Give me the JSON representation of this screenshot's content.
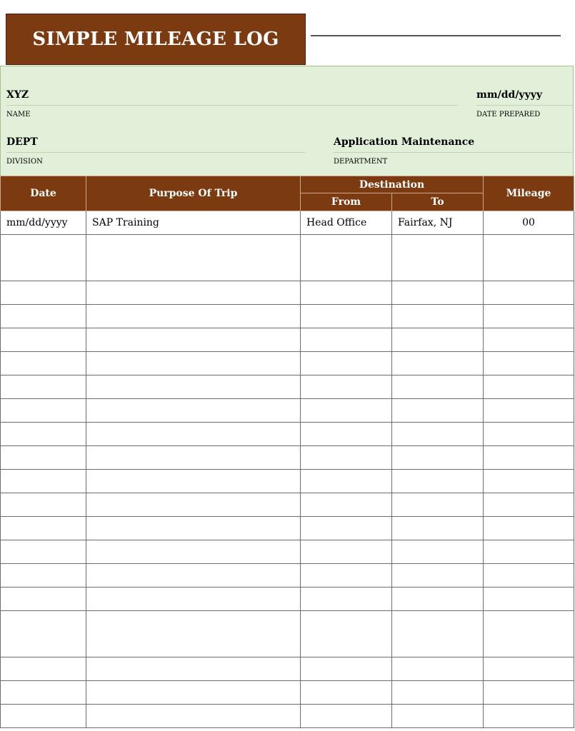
{
  "header": {
    "title": "SIMPLE MILEAGE LOG"
  },
  "info": {
    "name_value": "XYZ",
    "name_label": "NAME",
    "date_value": "mm/dd/yyyy",
    "date_label": "DATE PREPARED",
    "division_value": "DEPT",
    "division_label": "DIVISION",
    "department_value": "Application Maintenance",
    "department_label": "DEPARTMENT"
  },
  "table": {
    "columns": {
      "date": "Date",
      "purpose": "Purpose Of Trip",
      "destination": "Destination",
      "from": "From",
      "to": "To",
      "mileage": "Mileage"
    },
    "rows": [
      {
        "date": "mm/dd/yyyy",
        "purpose": "SAP Training",
        "from": "Head Office",
        "to": "Fairfax, NJ",
        "mileage": "00",
        "tall": false
      },
      {
        "date": "",
        "purpose": "",
        "from": "",
        "to": "",
        "mileage": "",
        "tall": true
      },
      {
        "date": "",
        "purpose": "",
        "from": "",
        "to": "",
        "mileage": "",
        "tall": false
      },
      {
        "date": "",
        "purpose": "",
        "from": "",
        "to": "",
        "mileage": "",
        "tall": false
      },
      {
        "date": "",
        "purpose": "",
        "from": "",
        "to": "",
        "mileage": "",
        "tall": false
      },
      {
        "date": "",
        "purpose": "",
        "from": "",
        "to": "",
        "mileage": "",
        "tall": false
      },
      {
        "date": "",
        "purpose": "",
        "from": "",
        "to": "",
        "mileage": "",
        "tall": false
      },
      {
        "date": "",
        "purpose": "",
        "from": "",
        "to": "",
        "mileage": "",
        "tall": false
      },
      {
        "date": "",
        "purpose": "",
        "from": "",
        "to": "",
        "mileage": "",
        "tall": false
      },
      {
        "date": "",
        "purpose": "",
        "from": "",
        "to": "",
        "mileage": "",
        "tall": false
      },
      {
        "date": "",
        "purpose": "",
        "from": "",
        "to": "",
        "mileage": "",
        "tall": false
      },
      {
        "date": "",
        "purpose": "",
        "from": "",
        "to": "",
        "mileage": "",
        "tall": false
      },
      {
        "date": "",
        "purpose": "",
        "from": "",
        "to": "",
        "mileage": "",
        "tall": false
      },
      {
        "date": "",
        "purpose": "",
        "from": "",
        "to": "",
        "mileage": "",
        "tall": false
      },
      {
        "date": "",
        "purpose": "",
        "from": "",
        "to": "",
        "mileage": "",
        "tall": false
      },
      {
        "date": "",
        "purpose": "",
        "from": "",
        "to": "",
        "mileage": "",
        "tall": false
      },
      {
        "date": "",
        "purpose": "",
        "from": "",
        "to": "",
        "mileage": "",
        "tall": true
      },
      {
        "date": "",
        "purpose": "",
        "from": "",
        "to": "",
        "mileage": "",
        "tall": false
      },
      {
        "date": "",
        "purpose": "",
        "from": "",
        "to": "",
        "mileage": "",
        "tall": false
      },
      {
        "date": "",
        "purpose": "",
        "from": "",
        "to": "",
        "mileage": "",
        "tall": false
      }
    ]
  },
  "colors": {
    "brand": "#7b3a10",
    "panel": "#e2efd9"
  }
}
